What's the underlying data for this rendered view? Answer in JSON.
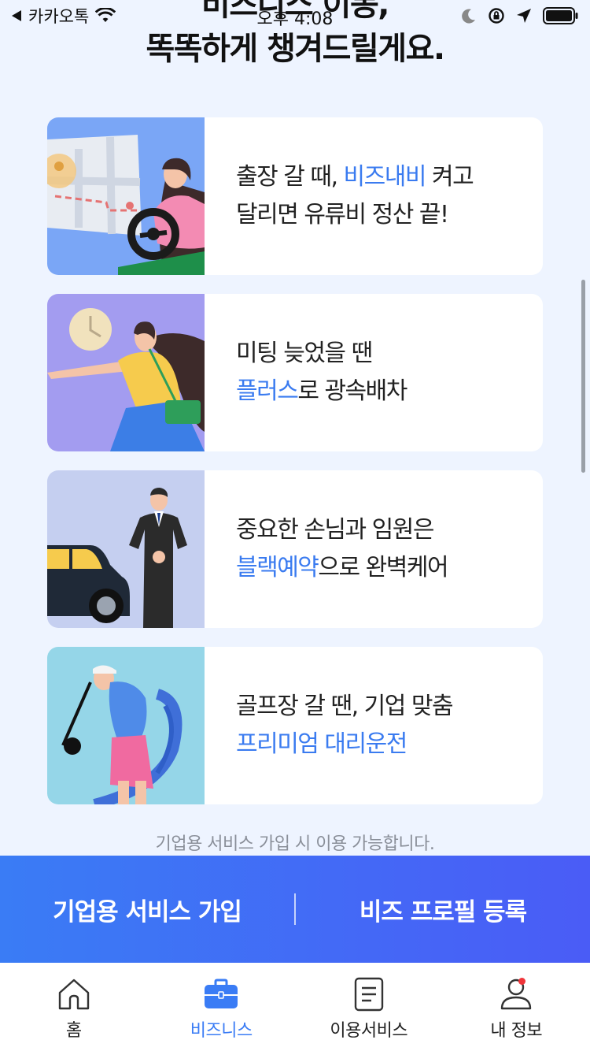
{
  "status_bar": {
    "back_app": "카카오톡",
    "time": "오후 4:08"
  },
  "heading": {
    "line1": "비즈니스 이동,",
    "line2": "똑똑하게 챙겨드릴게요."
  },
  "cards": [
    {
      "line1_pre": "출장 갈 때, ",
      "line1_hl": "비즈내비",
      "line1_post": " 켜고",
      "line2_pre": "달리면 유류비 정산 끝!",
      "line2_hl": "",
      "line2_post": ""
    },
    {
      "line1_pre": "미팅 늦었을 땐",
      "line1_hl": "",
      "line1_post": "",
      "line2_pre": "",
      "line2_hl": "플러스",
      "line2_post": "로 광속배차"
    },
    {
      "line1_pre": "중요한 손님과 임원은",
      "line1_hl": "",
      "line1_post": "",
      "line2_pre": "",
      "line2_hl": "블랙예약",
      "line2_post": "으로 완벽케어"
    },
    {
      "line1_pre": "골프장 갈 땐, 기업 맞춤",
      "line1_hl": "",
      "line1_post": "",
      "line2_pre": "",
      "line2_hl": "프리미엄 대리운전",
      "line2_post": ""
    }
  ],
  "footnote": "기업용 서비스 가입 시 이용 가능합니다.",
  "cta": {
    "signup_label": "기업용 서비스 가입",
    "profile_label": "비즈 프로필 등록"
  },
  "tabs": [
    {
      "label": "홈",
      "icon": "home-icon"
    },
    {
      "label": "비즈니스",
      "icon": "briefcase-icon"
    },
    {
      "label": "이용서비스",
      "icon": "document-icon"
    },
    {
      "label": "내 정보",
      "icon": "person-icon"
    }
  ],
  "colors": {
    "accent": "#3a7cf5",
    "background": "#eef4ff",
    "notification_dot": "#f0353a"
  }
}
